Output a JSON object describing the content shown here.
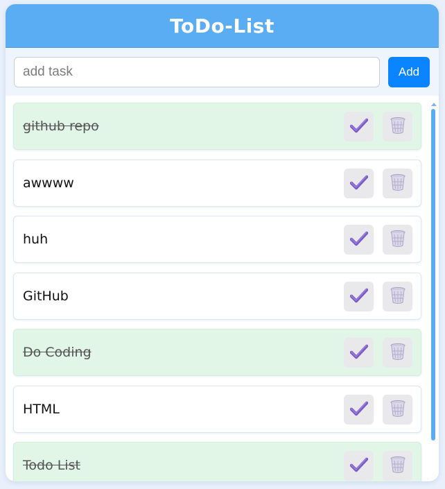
{
  "header": {
    "title": "ToDo-List"
  },
  "input_bar": {
    "placeholder": "add task",
    "add_label": "Add"
  },
  "tasks": [
    {
      "text": "github repo",
      "completed": true
    },
    {
      "text": "awwww",
      "completed": false
    },
    {
      "text": "huh",
      "completed": false
    },
    {
      "text": "GitHub",
      "completed": false
    },
    {
      "text": "Do Coding",
      "completed": true
    },
    {
      "text": "HTML",
      "completed": false
    },
    {
      "text": "Todo List",
      "completed": true
    }
  ],
  "icons": {
    "check": "check-mark-icon",
    "delete": "wastebasket-icon"
  },
  "colors": {
    "header_bg": "#5aacf3",
    "accent": "#0a84ff",
    "completed_bg": "#e2f6e8",
    "check_purple": "#7b5cc6"
  }
}
